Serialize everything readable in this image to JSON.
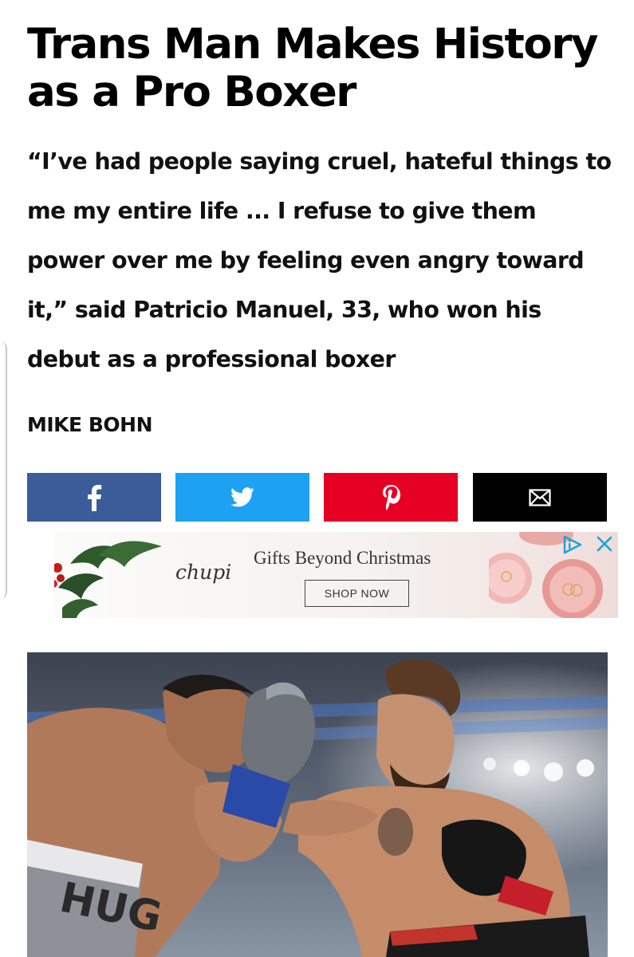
{
  "article": {
    "headline": "Trans Man Makes History as a Pro Boxer",
    "dek": "“I’ve had people saying cruel, hateful things to me my entire life ... I refuse to give them power over me by feeling even angry toward it,” said Patricio Manuel, 33, who won his debut as a professional boxer",
    "byline": "MIKE BOHN"
  },
  "share": {
    "buttons": [
      {
        "network": "facebook",
        "icon": "facebook-icon",
        "color": "#3b5b99"
      },
      {
        "network": "twitter",
        "icon": "twitter-bird-icon",
        "color": "#1da1f2"
      },
      {
        "network": "pinterest",
        "icon": "pinterest-icon",
        "color": "#e60023"
      },
      {
        "network": "email",
        "icon": "envelope-icon",
        "color": "#000000"
      }
    ]
  },
  "ad": {
    "brand": "chupi",
    "headline": "Gifts Beyond Christmas",
    "cta": "SHOP NOW",
    "choices_icon": "adchoices-icon",
    "close_icon": "close-icon",
    "accent_color": "#1aa3d9"
  },
  "photo": {
    "trunks_text": "HUG",
    "subject": "boxing-match-photo"
  }
}
